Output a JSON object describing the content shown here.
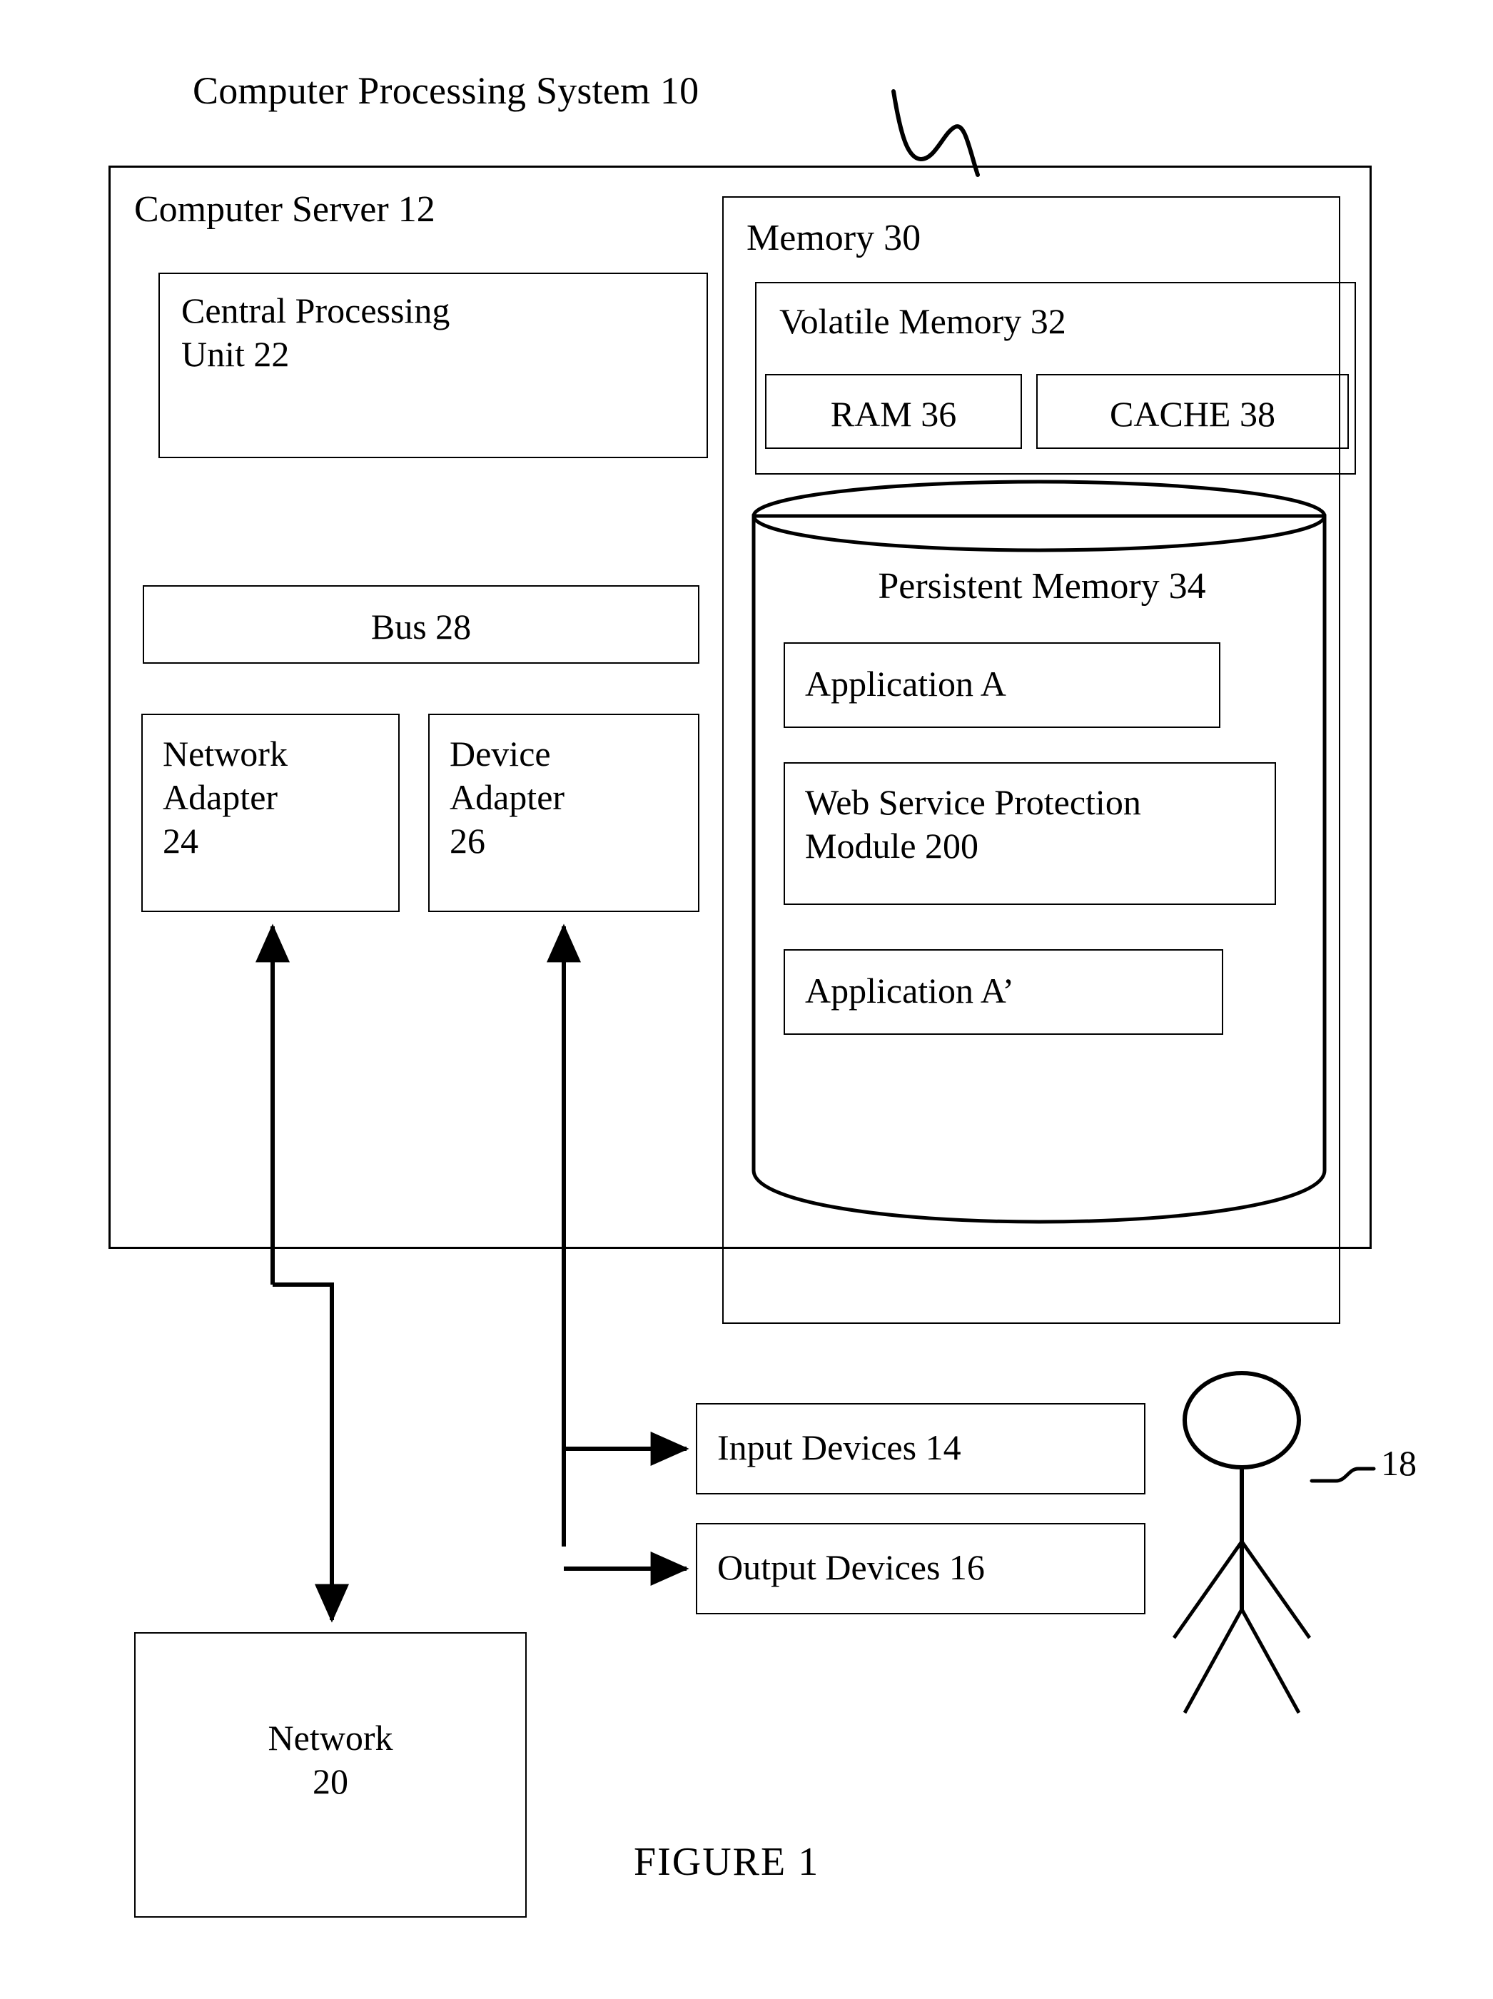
{
  "figure": {
    "caption": "FIGURE 1",
    "title": "Computer Processing System 10"
  },
  "server": {
    "label": "Computer Server 12",
    "cpu": {
      "label": "Central Processing\nUnit 22"
    },
    "bus": {
      "label": "Bus 28"
    },
    "network_adapter": {
      "label": "Network\nAdapter\n24"
    },
    "device_adapter": {
      "label": "Device\nAdapter\n26"
    }
  },
  "memory": {
    "label": "Memory 30",
    "volatile": {
      "label": "Volatile Memory 32",
      "ram": {
        "label": "RAM 36"
      },
      "cache": {
        "label": "CACHE 38"
      }
    },
    "persistent": {
      "label": "Persistent Memory 34",
      "items": [
        {
          "label": "Application A"
        },
        {
          "label": "Web Service Protection\nModule 200"
        },
        {
          "label": "Application A’"
        }
      ]
    }
  },
  "peripherals": {
    "input_devices": {
      "label": "Input Devices 14"
    },
    "output_devices": {
      "label": "Output Devices 16"
    },
    "user": {
      "ref_label": "18"
    }
  },
  "network": {
    "label": "Network\n20"
  },
  "colors": {
    "ink": "#000000",
    "paper": "#ffffff"
  }
}
